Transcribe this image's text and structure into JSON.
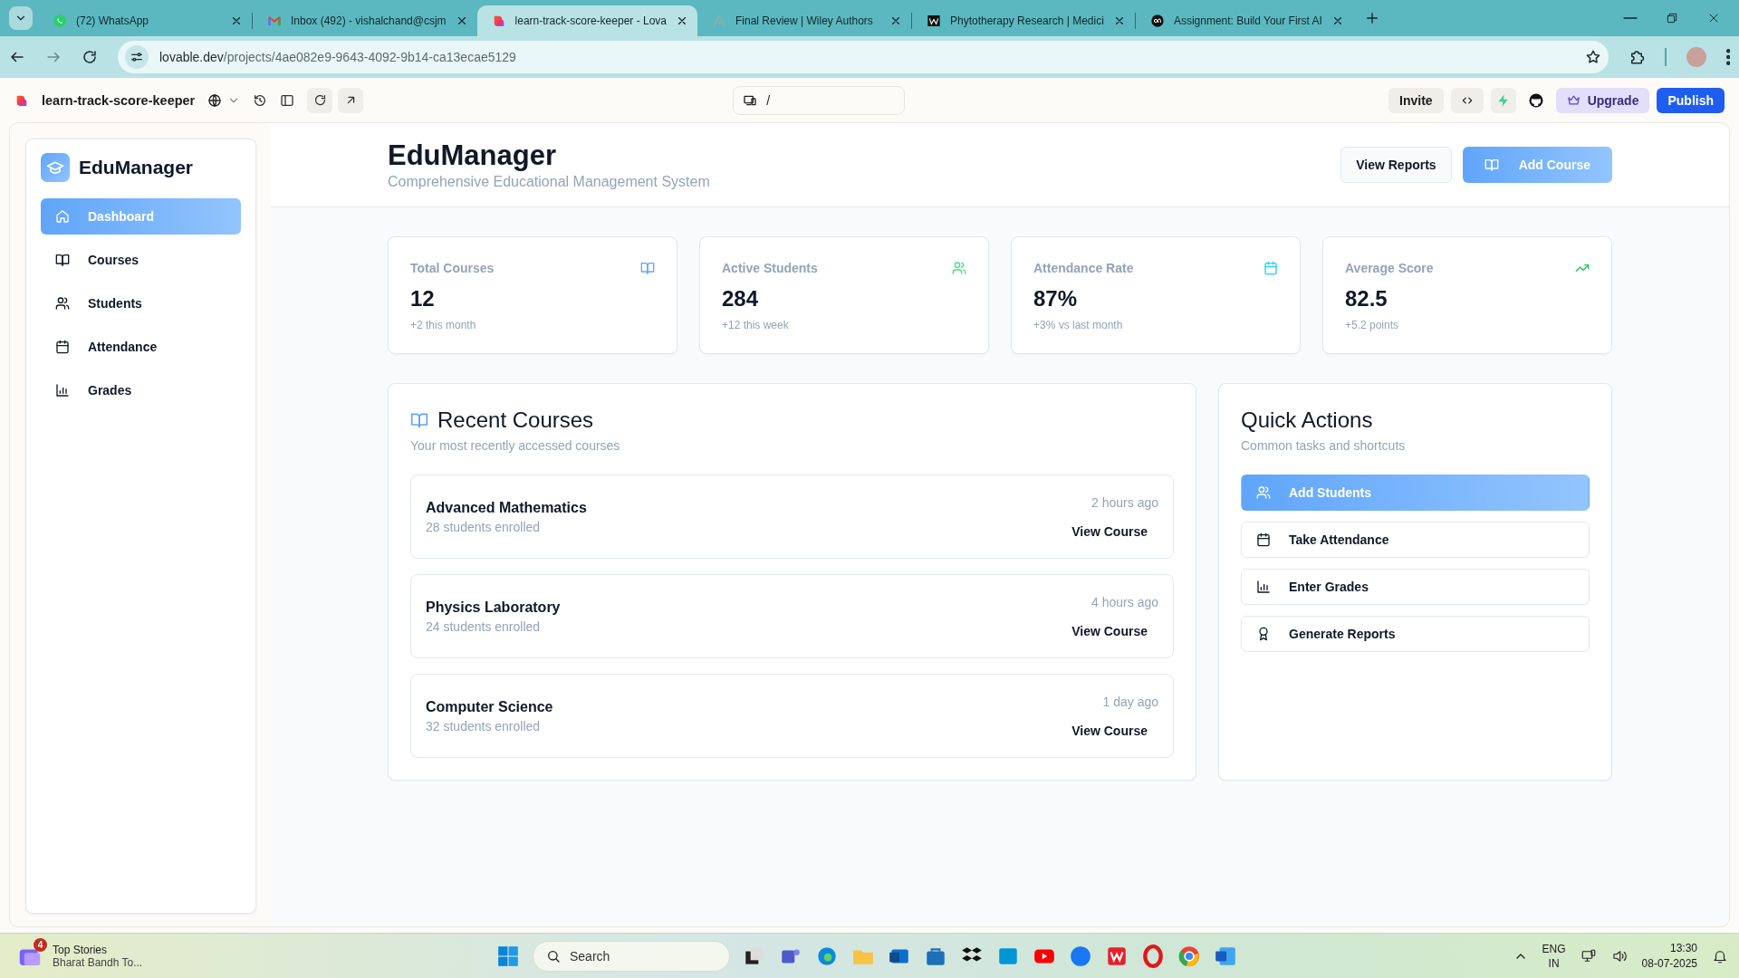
{
  "browser": {
    "tabs": [
      {
        "title": "(72) WhatsApp",
        "selected": false
      },
      {
        "title": "Inbox (492) - vishalchand@csjm",
        "selected": false
      },
      {
        "title": "learn-track-score-keeper - Lova",
        "selected": true
      },
      {
        "title": "Final Review | Wiley Authors",
        "selected": false
      },
      {
        "title": "Phytotherapy Research | Medici",
        "selected": false
      },
      {
        "title": "Assignment: Build Your First AI",
        "selected": false
      }
    ],
    "url_host": "lovable.dev",
    "url_path": "/projects/4ae082e9-9643-4092-9b14-ca13ecae5129"
  },
  "project_bar": {
    "project_name": "learn-track-score-keeper",
    "path": "/",
    "buttons": [
      {
        "label": "Invite",
        "kind": "plain"
      },
      {
        "label": "Upgrade",
        "kind": "upgrade"
      },
      {
        "label": "Publish",
        "kind": "primary"
      }
    ]
  },
  "sidebar": {
    "brand": "EduManager",
    "items": [
      {
        "label": "Dashboard",
        "selected": true
      },
      {
        "label": "Courses",
        "selected": false
      },
      {
        "label": "Students",
        "selected": false
      },
      {
        "label": "Attendance",
        "selected": false
      },
      {
        "label": "Grades",
        "selected": false
      }
    ]
  },
  "header": {
    "title": "EduManager",
    "subtitle": "Comprehensive Educational Management System",
    "buttons": [
      {
        "label": "View Reports",
        "kind": "outline"
      },
      {
        "label": "Add Course",
        "kind": "primary"
      }
    ]
  },
  "stats": [
    {
      "label": "Total Courses",
      "value": "12",
      "note": "+2 this month",
      "color": "#60a5fa"
    },
    {
      "label": "Active Students",
      "value": "284",
      "note": "+12 this week",
      "color": "#4ade80"
    },
    {
      "label": "Attendance Rate",
      "value": "87%",
      "note": "+3% vs last month",
      "color": "#22d3ee"
    },
    {
      "label": "Average Score",
      "value": "82.5",
      "note": "+5.2 points",
      "color": "#22c55e"
    }
  ],
  "recent_courses": {
    "title": "Recent Courses",
    "subtitle": "Your most recently accessed courses",
    "courses": [
      {
        "name": "Advanced Mathematics",
        "enrolled": "28 students enrolled",
        "time": "2 hours ago",
        "action": "View Course"
      },
      {
        "name": "Physics Laboratory",
        "enrolled": "24 students enrolled",
        "time": "4 hours ago",
        "action": "View Course"
      },
      {
        "name": "Computer Science",
        "enrolled": "32 students enrolled",
        "time": "1 day ago",
        "action": "View Course"
      }
    ]
  },
  "quick_actions": {
    "title": "Quick Actions",
    "subtitle": "Common tasks and shortcuts",
    "actions": [
      {
        "label": "Add Students",
        "selected": true
      },
      {
        "label": "Take Attendance",
        "selected": false
      },
      {
        "label": "Enter Grades",
        "selected": false
      },
      {
        "label": "Generate Reports",
        "selected": false
      }
    ]
  },
  "taskbar": {
    "news_badge": "4",
    "news_title": "Top Stories",
    "news_text": "Bharat Bandh To...",
    "search_placeholder": "Search",
    "language": "ENG",
    "region": "IN",
    "time": "13:30",
    "date": "08-07-2025"
  }
}
